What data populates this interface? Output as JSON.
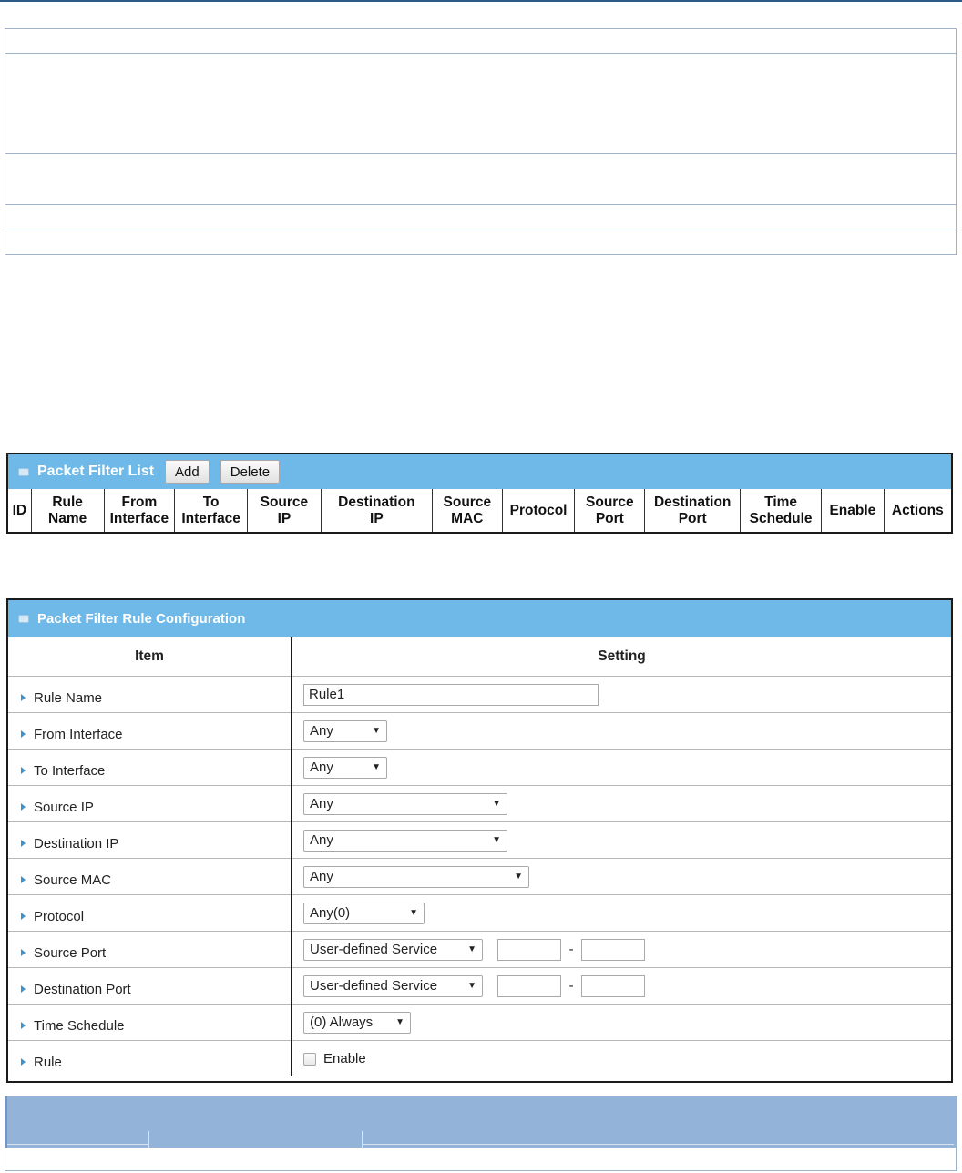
{
  "packet_filter_list": {
    "title": "Packet Filter List",
    "add_label": "Add",
    "delete_label": "Delete",
    "columns": [
      {
        "line1": "ID",
        "line2": ""
      },
      {
        "line1": "Rule",
        "line2": "Name"
      },
      {
        "line1": "From",
        "line2": "Interface"
      },
      {
        "line1": "To",
        "line2": "Interface"
      },
      {
        "line1": "Source",
        "line2": "IP"
      },
      {
        "line1": "Destination",
        "line2": "IP"
      },
      {
        "line1": "Source",
        "line2": "MAC"
      },
      {
        "line1": "Protocol",
        "line2": ""
      },
      {
        "line1": "Source",
        "line2": "Port"
      },
      {
        "line1": "Destination",
        "line2": "Port"
      },
      {
        "line1": "Time",
        "line2": "Schedule"
      },
      {
        "line1": "Enable",
        "line2": ""
      },
      {
        "line1": "Actions",
        "line2": ""
      }
    ]
  },
  "rule_config": {
    "title": "Packet Filter Rule Configuration",
    "header_item": "Item",
    "header_setting": "Setting",
    "rule_name": {
      "label": "Rule Name",
      "value": "Rule1"
    },
    "from_interface": {
      "label": "From Interface",
      "value": "Any"
    },
    "to_interface": {
      "label": "To Interface",
      "value": "Any"
    },
    "source_ip": {
      "label": "Source IP",
      "value": "Any"
    },
    "destination_ip": {
      "label": "Destination IP",
      "value": "Any"
    },
    "source_mac": {
      "label": "Source MAC",
      "value": "Any"
    },
    "protocol": {
      "label": "Protocol",
      "value": "Any(0)"
    },
    "source_port": {
      "label": "Source Port",
      "value": "User-defined Service",
      "range_from": "",
      "range_to": "",
      "separator": "-"
    },
    "destination_port": {
      "label": "Destination Port",
      "value": "User-defined Service",
      "range_from": "",
      "range_to": "",
      "separator": "-"
    },
    "time_schedule": {
      "label": "Time Schedule",
      "value": "(0) Always"
    },
    "rule": {
      "label": "Rule",
      "checkbox_label": "Enable",
      "checked": false
    }
  },
  "icons": {
    "panel_bullet": "panel-bullet-icon",
    "row_arrow": "triangle-right-icon",
    "select_caret": "caret-down-icon"
  },
  "colors": {
    "panel_header": "#6fb9e9",
    "row_arrow": "#3c95cf",
    "bottom_band": "#93b3d8"
  }
}
